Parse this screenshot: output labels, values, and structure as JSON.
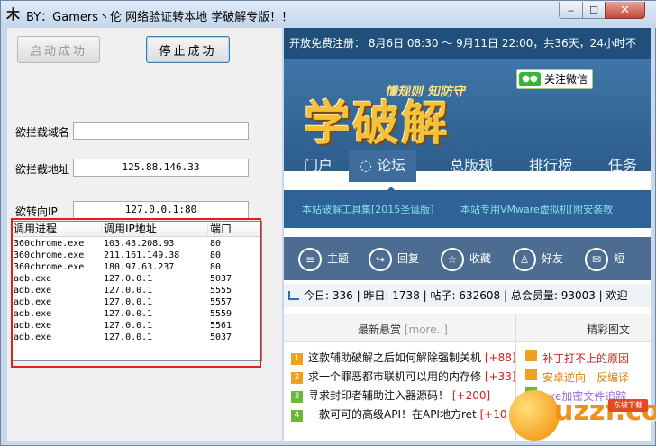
{
  "window": {
    "title": "BY：Gamers丶伦 网络验证转本地 学破解专版！！",
    "app_icon": "木",
    "controls": {
      "minimize": "‒",
      "maximize": "☐",
      "close": "✕"
    }
  },
  "left": {
    "start_button": "启动成功",
    "stop_button": "停止成功",
    "fields": [
      {
        "label": "欲拦截域名",
        "value": ""
      },
      {
        "label": "欲拦截地址",
        "value": "125.88.146.33"
      },
      {
        "label": "欲转向IP",
        "value": "127.0.0.1:80"
      }
    ],
    "table": {
      "headers": [
        "调用进程",
        "调用IP地址",
        "端口"
      ],
      "rows": [
        [
          "360chrome.exe",
          "103.43.208.93",
          "80"
        ],
        [
          "360chrome.exe",
          "211.161.149.38",
          "80"
        ],
        [
          "360chrome.exe",
          "180.97.63.237",
          "80"
        ],
        [
          "adb.exe",
          "127.0.0.1",
          "5037"
        ],
        [
          "adb.exe",
          "127.0.0.1",
          "5555"
        ],
        [
          "adb.exe",
          "127.0.0.1",
          "5557"
        ],
        [
          "adb.exe",
          "127.0.0.1",
          "5559"
        ],
        [
          "adb.exe",
          "127.0.0.1",
          "5561"
        ],
        [
          "adb.exe",
          "127.0.0.1",
          "5037"
        ]
      ]
    }
  },
  "browser": {
    "announcement": "开放免费注册： 8月6日 08:30 ～ 9月11日 22:00，共36天，24小时不",
    "logo": "学破解",
    "slogan": "懂规则 知防守",
    "wechat": "关注微信",
    "nav": [
      "门户",
      "论坛",
      "总版规",
      "排行榜",
      "任务"
    ],
    "sub_links": [
      "本站破解工具集[2015圣诞版]",
      "本站专用VMware虚拟机[附安装教"
    ],
    "actions": [
      "主题",
      "回复",
      "收藏",
      "好友",
      "短"
    ],
    "action_icons": [
      "list-icon",
      "reply-icon",
      "star-icon",
      "friends-icon",
      "message-icon"
    ],
    "stats": "今日: 336 | 昨日: 1738 | 帖子: 632608 | 总会员量: 93003 | 欢迎",
    "news_title": "最新悬赏",
    "news_more": "[more..]",
    "right_title": "精彩图文",
    "news": [
      {
        "num": "1",
        "text": "这款辅助破解之后如何解除强制关机",
        "count": "[+88]",
        "color": "#f0a020"
      },
      {
        "num": "2",
        "text": "求一个罪恶都市联机可以用的内存修",
        "count": "[+33]",
        "color": "#f0a020"
      },
      {
        "num": "3",
        "text": "寻求封印者辅助注入器源码！",
        "count": "[+200]",
        "color": "#6cb83a"
      },
      {
        "num": "4",
        "text": "一款可可的高级API！在API地方ret",
        "count": "[+10",
        "color": "#6cb83a"
      }
    ],
    "right_news": [
      {
        "text": "补丁打不上的原因",
        "color": "#d02020"
      },
      {
        "text": "安卓逆向 - 反编译",
        "color": "#e08000"
      },
      {
        "text": "exe加密文件追踪",
        "color": "#9a6fd0"
      }
    ],
    "watermark": {
      "main": "uzzf.com",
      "sub": "东坡下载"
    }
  }
}
